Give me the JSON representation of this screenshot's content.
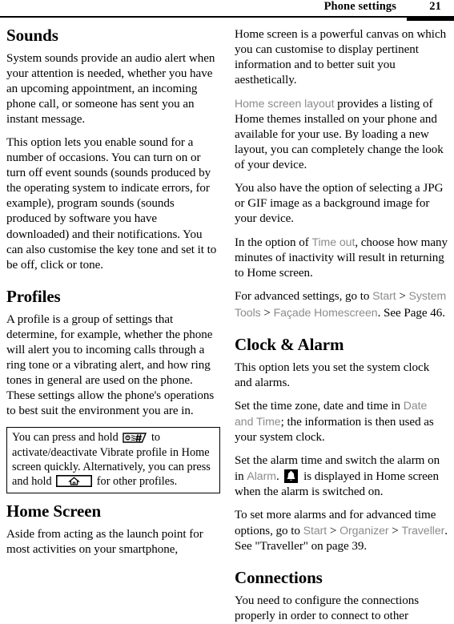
{
  "header": {
    "title": "Phone settings",
    "page_number": "21"
  },
  "left_column": {
    "sections": [
      {
        "heading": "Sounds",
        "paragraphs": [
          "System sounds provide an audio alert when your attention is needed, whether you have an upcoming appointment, an incoming phone call, or someone has sent you an instant message.",
          "This option lets you enable sound for a number of occasions. You can turn on or turn off event sounds (sounds produced by the operating system to indicate errors, for example), program sounds (sounds produced by software you have downloaded) and their notifications. You can also customise the key tone and set it to be off, click or tone."
        ]
      },
      {
        "heading": "Profiles",
        "paragraphs": [
          "A profile is a group of settings that determine, for example, whether the phone will alert you to incoming calls through a ring tone or a vibrating alert, and how ring tones in general are used on the phone. These settings allow the phone's operations to best suit the environment you are in."
        ]
      }
    ],
    "note_box": {
      "text_1": "You can press and hold",
      "icon_1": "hash-key-icon",
      "text_2": "to activate/deactivate Vibrate profile in Home screen quickly. Alternatively, you can press and hold",
      "icon_2": "home-key-icon",
      "text_3": "for other profiles."
    },
    "final_section": {
      "heading": "Home Screen",
      "paragraph": "Aside from acting as the launch point for most activities on your smartphone,"
    }
  },
  "right_column": {
    "continuation": [
      "Home screen is a powerful canvas on which you can customise to display pertinent information and to better suit you aesthetically."
    ],
    "layout_paragraph": {
      "ui_term": "Home screen layout",
      "rest": " provides a listing of Home themes installed on your phone and available for your use. By loading a new layout, you can completely change the look of your device."
    },
    "jpg_paragraph": "You also have the option of selecting a JPG or GIF image as a background image for your device.",
    "timeout_paragraph": {
      "prefix": "In the option of ",
      "ui_term": "Time out",
      "rest": ", choose how many minutes of inactivity will result in returning to Home screen."
    },
    "advanced_paragraph": {
      "prefix": "For advanced settings, go to ",
      "ui_term_1": "Start",
      "sep_1": " > ",
      "ui_term_2": "System Tools",
      "sep_2": " > ",
      "ui_term_3": "Façade Homescreen",
      "rest": ". See Page 46."
    },
    "clock_section": {
      "heading": "Clock & Alarm",
      "paragraph_1": "This option lets you set the system clock and alarms.",
      "paragraph_2": {
        "prefix": "Set the time zone, date and time in ",
        "ui_term": "Date and Time",
        "rest": "; the information is then used as your system clock."
      },
      "paragraph_3": {
        "prefix": "Set the alarm time and switch the alarm on in ",
        "ui_term": "Alarm",
        "mid": ". ",
        "icon": "alarm-bell-icon",
        "rest": " is displayed in Home screen when the alarm is switched on."
      },
      "paragraph_4": {
        "prefix": "To set more alarms and for advanced time options, go to ",
        "ui_term_1": "Start",
        "sep_1": " > ",
        "ui_term_2": "Organizer",
        "sep_2": " > ",
        "ui_term_3": "Traveller",
        "rest": ". See \"Traveller\" on page 39."
      }
    },
    "connections_section": {
      "heading": "Connections",
      "paragraph": "You need to configure the connections properly in order to connect to other"
    }
  },
  "colors": {
    "text": "#000000",
    "ui_term": "#8c8c8c",
    "rule": "#000000",
    "background": "#ffffff"
  }
}
